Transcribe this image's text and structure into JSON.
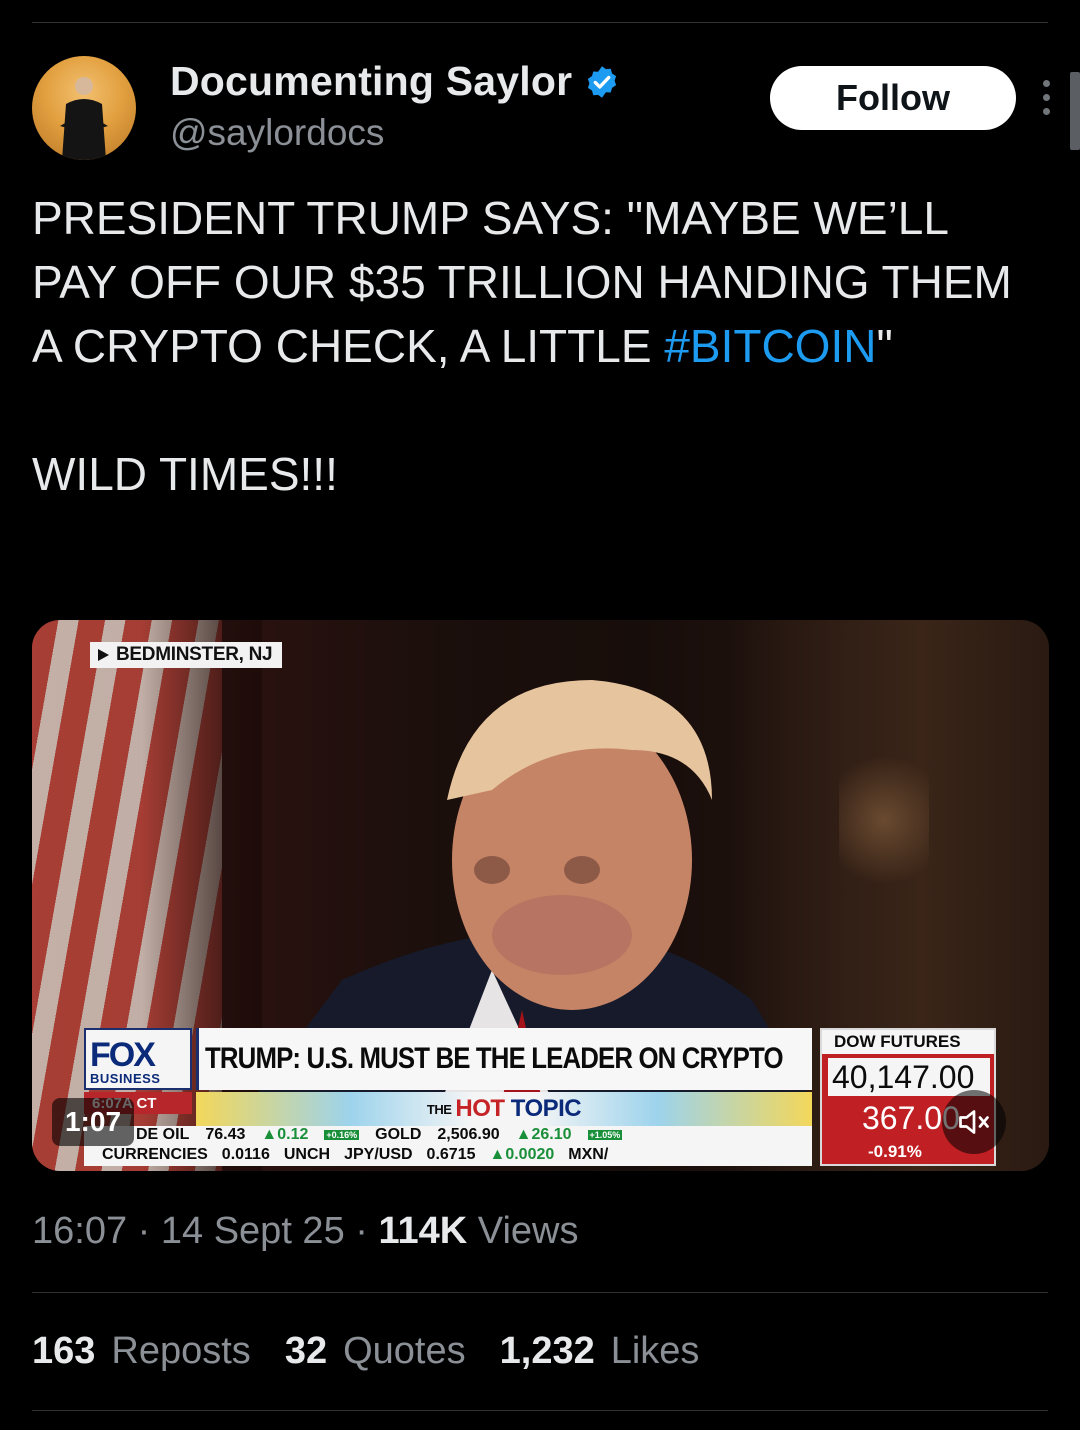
{
  "author": {
    "display_name": "Documenting Saylor",
    "handle": "@saylordocs",
    "verified_icon": "verified-badge-icon",
    "avatar_icon": "avatar"
  },
  "actions": {
    "follow_label": "Follow",
    "more_icon": "more-vertical-icon"
  },
  "tweet": {
    "line1": "PRESIDENT TRUMP SAYS: \"MAYBE WE’LL PAY OFF OUR $35 TRILLION HANDING THEM A CRYPTO CHECK, A LITTLE ",
    "hashtag": "#BITCOIN",
    "line1_end": "\"",
    "line2": "WILD TIMES!!!"
  },
  "media": {
    "location": "BEDMINSTER, NJ",
    "network": "FOX",
    "network_sub": "BUSINESS",
    "headline": "TRUMP: U.S. MUST BE THE LEADER ON CRYPTO",
    "time_tag": "6:07A CT",
    "hot_topic_the": "THE",
    "hot_topic_hot": "HOT",
    "hot_topic_topic": "TOPIC",
    "ticker": {
      "crude_label": "DE OIL",
      "crude_value": "76.43",
      "crude_change": "▲0.12",
      "crude_pct": "+0.16%",
      "gold_label": "GOLD",
      "gold_value": "2,506.90",
      "gold_change": "▲26.10",
      "gold_pct": "+1.05%",
      "currencies_label": "CURRENCIES",
      "cur1_value": "0.0116",
      "cur1_change": "UNCH",
      "jpy_label": "JPY/USD",
      "jpy_value": "0.6715",
      "jpy_change": "▲0.0020",
      "mxn_label": "MXN/"
    },
    "dow": {
      "label": "DOW FUTURES",
      "value": "40,147.00",
      "change": "367.00",
      "pct": "-0.91%"
    },
    "duration": "1:07",
    "mute_icon": "speaker-muted-icon"
  },
  "meta": {
    "time": "16:07",
    "date": "14 Sept 25",
    "views_count": "114K",
    "views_label": "Views"
  },
  "stats": {
    "reposts_count": "163",
    "reposts_label": "Reposts",
    "quotes_count": "32",
    "quotes_label": "Quotes",
    "likes_count": "1,232",
    "likes_label": "Likes"
  },
  "colors": {
    "background": "#000000",
    "text": "#e7e9ea",
    "secondary_text": "#8b9096",
    "link": "#1d9bf0",
    "verified": "#1d9bf0",
    "follow_bg": "#ffffff"
  }
}
